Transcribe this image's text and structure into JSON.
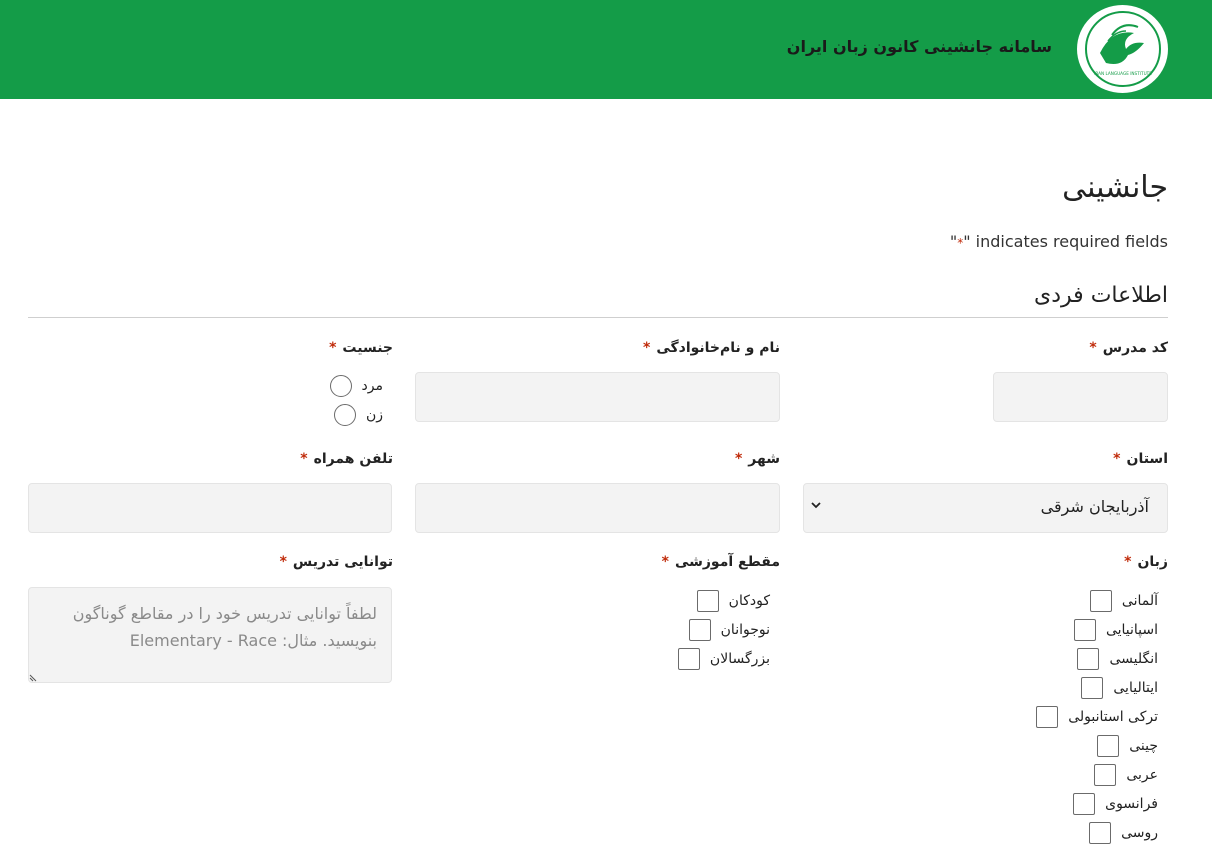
{
  "header": {
    "site_title": "سامانه جانشینی کانون زبان ایران",
    "logo_text": "IRAN LANGUAGE INSTITUTE"
  },
  "form": {
    "title": "جانشینی",
    "required_note_prefix": "\"",
    "required_note_star": "*",
    "required_note_suffix": "\" indicates required fields",
    "section_title": "اطلاعات فردی",
    "required_star": "*",
    "teacher_code": {
      "label": "کد مدرس",
      "value": ""
    },
    "full_name": {
      "label": "نام و نام‌خانوادگی",
      "value": ""
    },
    "gender": {
      "label": "جنسیت",
      "options": [
        "مرد",
        "زن"
      ]
    },
    "province": {
      "label": "استان",
      "selected": "آذربایجان شرقی"
    },
    "city": {
      "label": "شهر",
      "value": ""
    },
    "mobile": {
      "label": "تلفن همراه",
      "value": ""
    },
    "language": {
      "label": "زبان",
      "options": [
        "آلمانی",
        "اسپانیایی",
        "انگلیسی",
        "ایتالیایی",
        "ترکی استانبولی",
        "چینی",
        "عربی",
        "فرانسوی",
        "روسی"
      ]
    },
    "level": {
      "label": "مقطع آموزشی",
      "options": [
        "کودکان",
        "نوجوانان",
        "بزرگسالان"
      ]
    },
    "teaching_ability": {
      "label": "توانایی تدریس",
      "placeholder": "لطفاً توانایی تدریس خود را در مقاطع گوناگون بنویسید. مثال: Elementary - Race"
    }
  },
  "colors": {
    "brand": "#149c48",
    "required": "#c02b0a",
    "field_bg": "#f3f3f3"
  }
}
